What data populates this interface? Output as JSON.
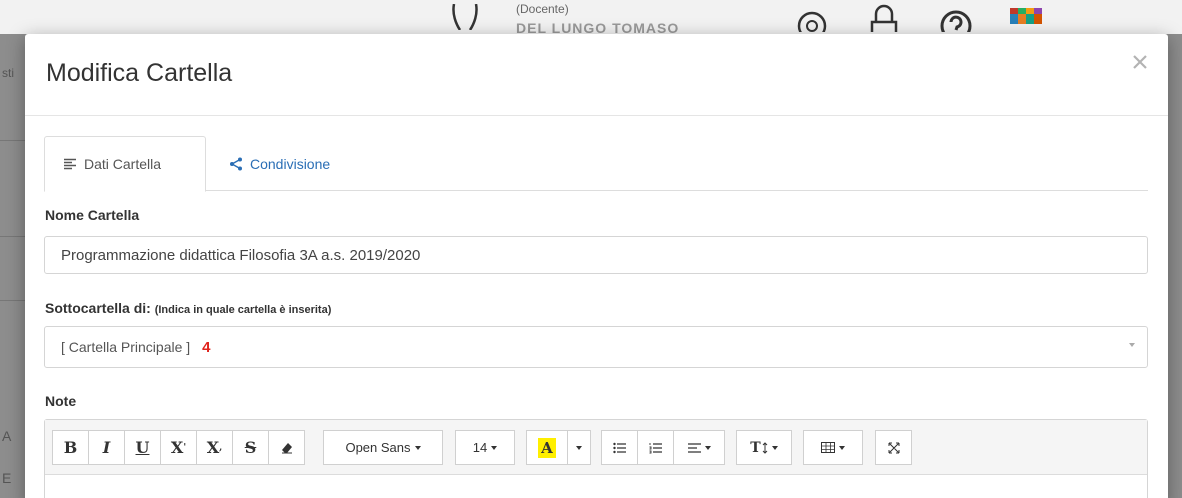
{
  "background": {
    "user_role": "(Docente)",
    "user_name": "DEL LUNGO TOMASO",
    "left_text_top": "sti",
    "left_text_mid": "A",
    "left_text_low": "E"
  },
  "modal": {
    "title": "Modifica Cartella",
    "tabs": [
      {
        "label": "Dati Cartella",
        "icon": "align-left-icon",
        "active": true
      },
      {
        "label": "Condivisione",
        "icon": "share-icon",
        "active": false
      }
    ],
    "fields": {
      "nome_label": "Nome Cartella",
      "nome_value": "Programmazione didattica Filosofia 3A a.s. 2019/2020",
      "sotto_label": "Sottocartella di:",
      "sotto_hint": "(Indica in quale cartella è inserita)",
      "sotto_value": "[ Cartella Principale ]",
      "sotto_badge": "4",
      "note_label": "Note"
    },
    "toolbar": {
      "bold": "B",
      "italic": "I",
      "underline": "U",
      "superscript": "X",
      "superscript_mark": "'",
      "subscript": "X",
      "subscript_mark": ",",
      "strike": "S",
      "font_name": "Open Sans",
      "font_size": "14",
      "highlight": "A",
      "height": "T"
    }
  },
  "colors": {
    "accent": "#2a6eb5",
    "badge": "#e0231c",
    "highlight": "#ffef00"
  }
}
